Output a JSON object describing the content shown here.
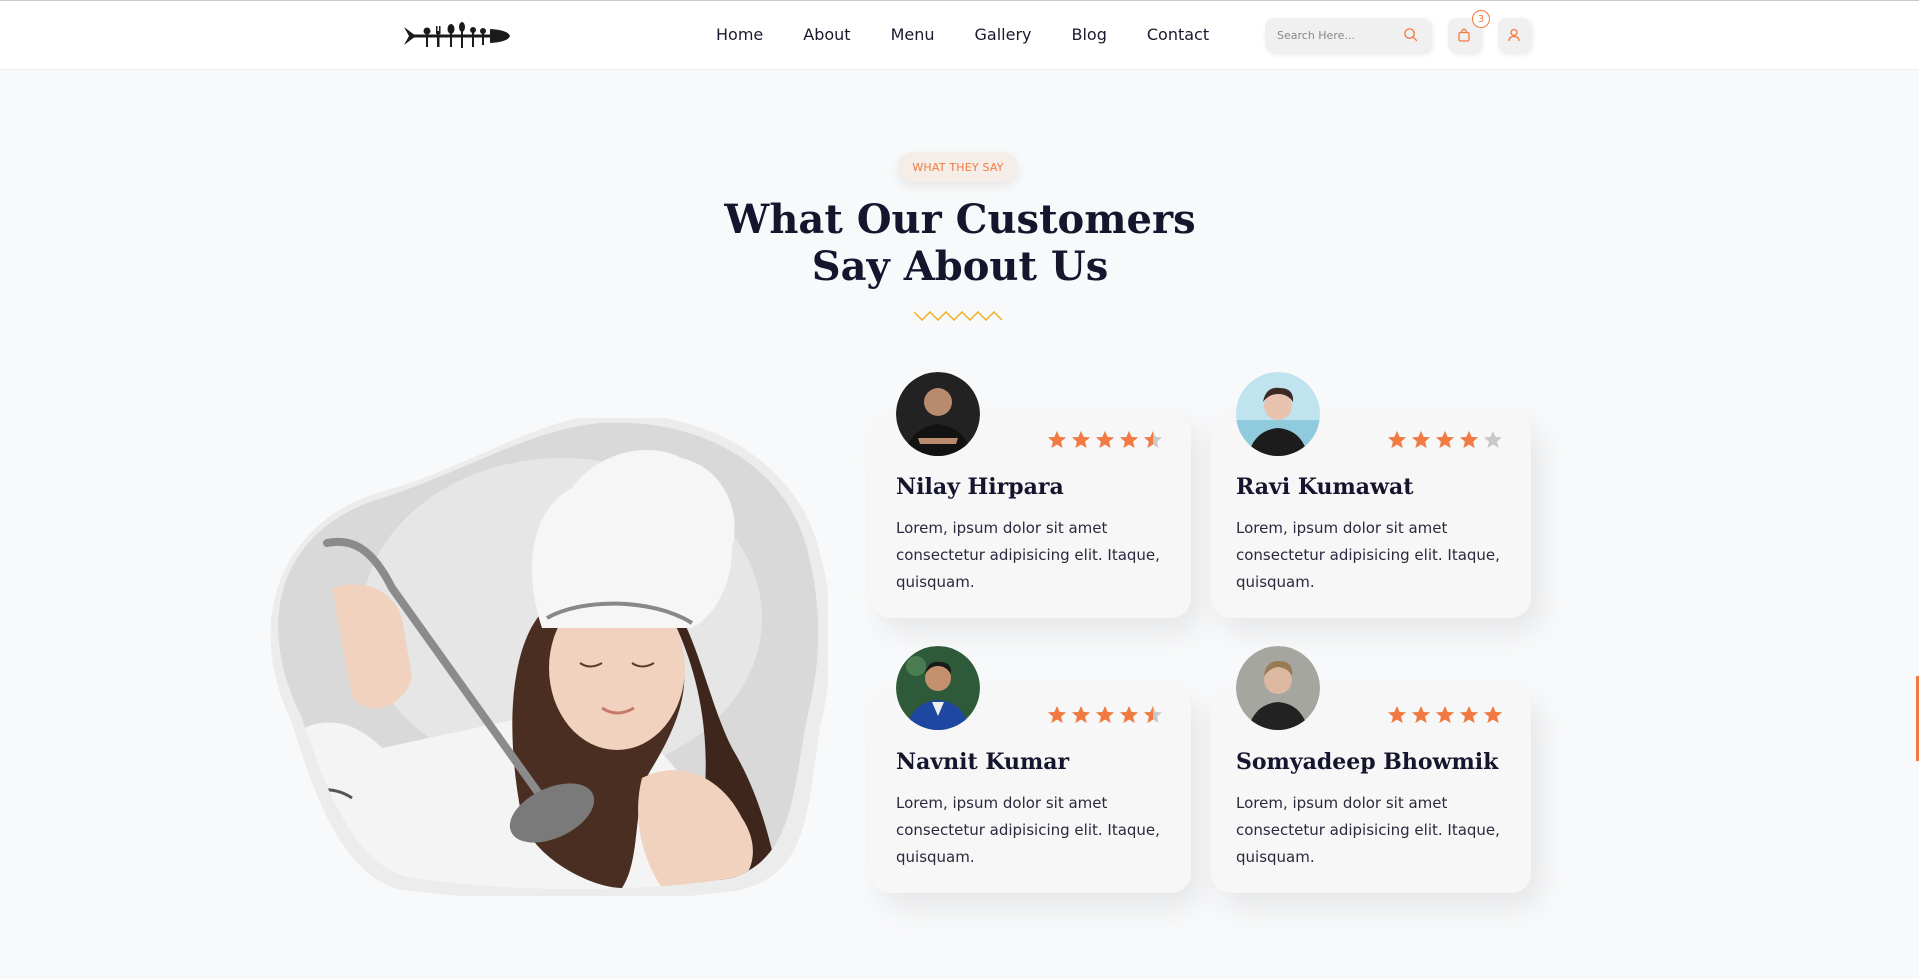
{
  "header": {
    "logo_name": "utensils-logo",
    "nav": [
      "Home",
      "About",
      "Menu",
      "Gallery",
      "Blog",
      "Contact"
    ],
    "search_placeholder": "Search Here...",
    "cart_count": "3"
  },
  "section": {
    "eyebrow": "WHAT THEY SAY",
    "title_line1": "What Our Customers",
    "title_line2": "Say About Us"
  },
  "testimonials": [
    {
      "name": "Nilay Hirpara",
      "rating": 4.5,
      "text": "Lorem, ipsum dolor sit amet consectetur adipisicing elit. Itaque, quisquam."
    },
    {
      "name": "Ravi Kumawat",
      "rating": 4,
      "text": "Lorem, ipsum dolor sit amet consectetur adipisicing elit. Itaque, quisquam."
    },
    {
      "name": "Navnit Kumar",
      "rating": 4.5,
      "text": "Lorem, ipsum dolor sit amet consectetur adipisicing elit. Itaque, quisquam."
    },
    {
      "name": "Somyadeep Bhowmik",
      "rating": 5,
      "text": "Lorem, ipsum dolor sit amet consectetur adipisicing elit. Itaque, quisquam."
    }
  ],
  "colors": {
    "accent": "#f27a40",
    "star_empty": "#c8c8c8",
    "title": "#15152e",
    "zigzag": "#f2b63a"
  }
}
